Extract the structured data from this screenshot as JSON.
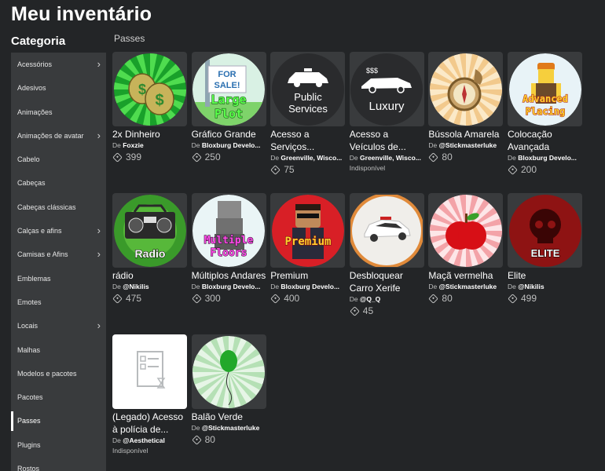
{
  "page": {
    "title": "Meu inventário",
    "category_title": "Categoria",
    "section": "Passes"
  },
  "sidebar": {
    "items": [
      {
        "label": "Acessórios",
        "chevron": true
      },
      {
        "label": "Adesivos",
        "chevron": false
      },
      {
        "label": "Animações",
        "chevron": false
      },
      {
        "label": "Animações de avatar",
        "chevron": true
      },
      {
        "label": "Cabelo",
        "chevron": false
      },
      {
        "label": "Cabeças",
        "chevron": false
      },
      {
        "label": "Cabeças clássicas",
        "chevron": false
      },
      {
        "label": "Calças e afins",
        "chevron": true
      },
      {
        "label": "Camisas e Afins",
        "chevron": true
      },
      {
        "label": "Emblemas",
        "chevron": false
      },
      {
        "label": "Emotes",
        "chevron": false
      },
      {
        "label": "Locais",
        "chevron": true
      },
      {
        "label": "Malhas",
        "chevron": false
      },
      {
        "label": "Modelos e pacotes",
        "chevron": false
      },
      {
        "label": "Pacotes",
        "chevron": false
      },
      {
        "label": "Passes",
        "chevron": false,
        "active": true
      },
      {
        "label": "Plugins",
        "chevron": false
      },
      {
        "label": "Rostos",
        "chevron": false
      }
    ]
  },
  "items": [
    {
      "name": "2x Dinheiro",
      "by": "De ",
      "creator": "Foxzie",
      "price": "399",
      "icon": "money-bags-icon",
      "thumb_text": ""
    },
    {
      "name": "Gráfico Grande",
      "by": "De ",
      "creator": "Bloxburg Develo...",
      "price": "250",
      "icon": "for-sale-sign-icon",
      "thumb_text": "Large Plot",
      "sign_text": "FOR SALE!"
    },
    {
      "name": "Acesso a Serviços...",
      "by": "De ",
      "creator": "Greenville, Wisco...",
      "price": "75",
      "icon": "police-car-icon",
      "thumb_text": "Public Services"
    },
    {
      "name": "Acesso a Veículos de...",
      "by": "De ",
      "creator": "Greenville, Wisco...",
      "price": null,
      "unavailable": "Indisponível",
      "icon": "luxury-car-icon",
      "thumb_text": "Luxury",
      "thumb_sub": "$$$"
    },
    {
      "name": "Bússola Amarela",
      "by": "De ",
      "creator": "@Stickmasterluke",
      "price": "80",
      "icon": "compass-icon",
      "thumb_text": ""
    },
    {
      "name": "Colocação Avançada",
      "by": "De ",
      "creator": "Bloxburg Develo...",
      "price": "200",
      "icon": "builder-avatar-icon",
      "thumb_text": "Advanced Placing"
    },
    {
      "name": "rádio",
      "by": "De ",
      "creator": "@Nikilis",
      "price": "475",
      "icon": "boombox-icon",
      "thumb_text": "Radio"
    },
    {
      "name": "Múltiplos Andares",
      "by": "De ",
      "creator": "Bloxburg Develo...",
      "price": "300",
      "icon": "floors-icon",
      "thumb_text": "Multiple Floors"
    },
    {
      "name": "Premium",
      "by": "De ",
      "creator": "Bloxburg Develo...",
      "price": "400",
      "icon": "premium-avatar-icon",
      "thumb_text": "Premium"
    },
    {
      "name": "Desbloquear Carro Xerife",
      "by": "De ",
      "creator": "@Q_Q",
      "price": "45",
      "icon": "sheriff-car-icon",
      "thumb_text": ""
    },
    {
      "name": "Maçã vermelha",
      "by": "De ",
      "creator": "@Stickmasterluke",
      "price": "80",
      "icon": "apple-icon",
      "thumb_text": ""
    },
    {
      "name": "Elite",
      "by": "De ",
      "creator": "@Nikilis",
      "price": "499",
      "icon": "skull-icon",
      "thumb_text": "ELITE"
    },
    {
      "name": "(Legado) Acesso à polícia de...",
      "by": "De ",
      "creator": "@Aesthetical",
      "price": null,
      "unavailable": "Indisponível",
      "icon": "placeholder-image-icon",
      "thumb_text": ""
    },
    {
      "name": "Balão Verde",
      "by": "De ",
      "creator": "@Stickmasterluke",
      "price": "80",
      "icon": "balloon-icon",
      "thumb_text": ""
    }
  ]
}
